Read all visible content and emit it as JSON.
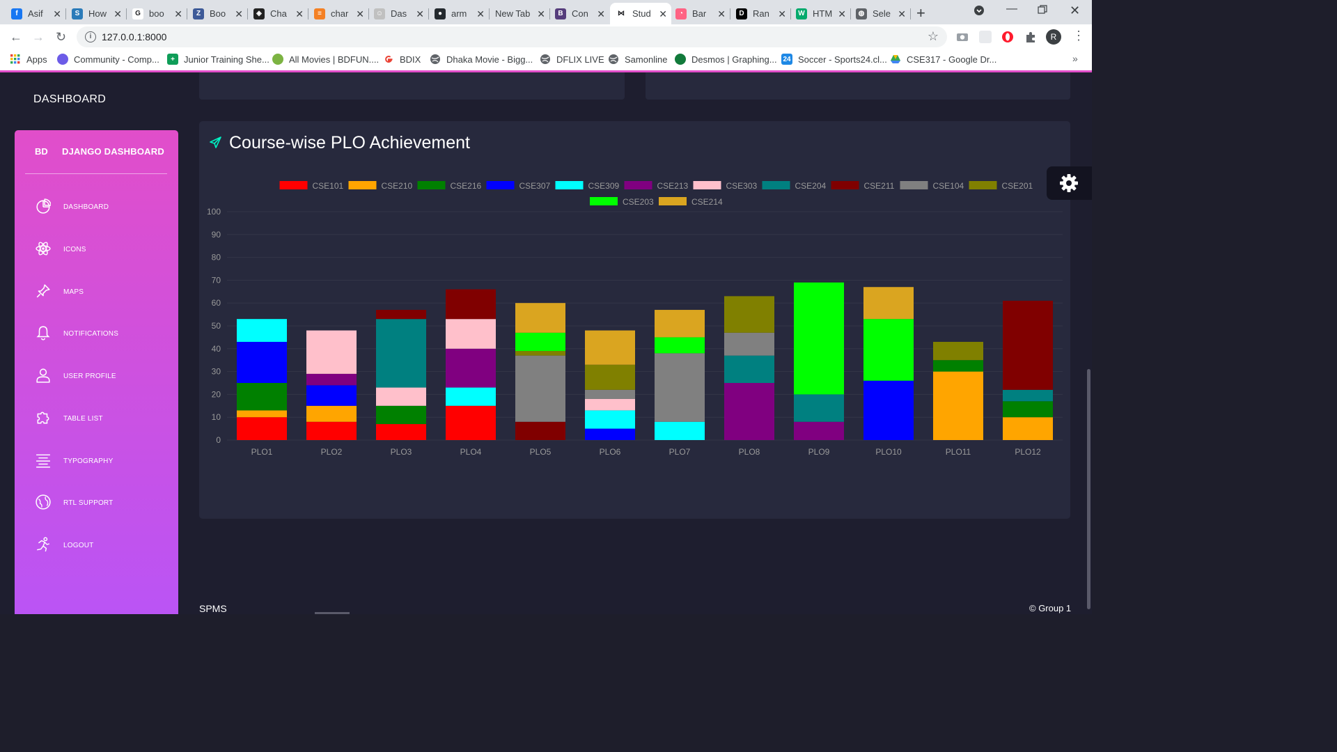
{
  "browser": {
    "tabs": [
      {
        "label": "Asif",
        "favicon": "facebook-icon",
        "color": "#1877f2",
        "glyph": "f"
      },
      {
        "label": "How",
        "favicon": "s-icon",
        "color": "#2b7bb9",
        "glyph": "S"
      },
      {
        "label": "boo",
        "favicon": "google-icon",
        "color": "#ffffff",
        "glyph": "G"
      },
      {
        "label": "Boo",
        "favicon": "bootstrap-icon",
        "color": "#3d5a98",
        "glyph": "Z"
      },
      {
        "label": "Cha",
        "favicon": "codepen-icon",
        "color": "#222222",
        "glyph": "◈"
      },
      {
        "label": "char",
        "favicon": "stackoverflow-icon",
        "color": "#f48024",
        "glyph": "≡"
      },
      {
        "label": "Das",
        "favicon": "page-icon",
        "color": "#c0c0c0",
        "glyph": "☺"
      },
      {
        "label": "arm",
        "favicon": "github-icon",
        "color": "#24292e",
        "glyph": "●"
      },
      {
        "label": "New Tab",
        "favicon": "",
        "color": "",
        "glyph": ""
      },
      {
        "label": "Con",
        "favicon": "bootstrap-b-icon",
        "color": "#563d7c",
        "glyph": "B"
      },
      {
        "label": "Stud",
        "favicon": "bow-icon",
        "color": "#ffffff",
        "glyph": "⋈"
      },
      {
        "label": "Bar",
        "favicon": "chartjs-icon",
        "color": "#ff6384",
        "glyph": "◔"
      },
      {
        "label": "Ran",
        "favicon": "dev-icon",
        "color": "#000000",
        "glyph": "D"
      },
      {
        "label": "HTM",
        "favicon": "w3-icon",
        "color": "#04aa6d",
        "glyph": "W"
      },
      {
        "label": "Sele",
        "favicon": "globe-icon",
        "color": "#5f6368",
        "glyph": "◍"
      }
    ],
    "active_tab": 10,
    "url": "127.0.0.1:8000",
    "profile_initial": "R",
    "bookmarks": [
      {
        "label": "Apps",
        "icon": "apps-grid-icon",
        "color": "#ea4335"
      },
      {
        "label": "Community - Comp...",
        "icon": "community-icon",
        "color": "#6c5ce7"
      },
      {
        "label": "Junior Training She...",
        "icon": "sheets-icon",
        "color": "#0f9d58"
      },
      {
        "label": "All Movies | BDFUN....",
        "icon": "leaf-icon",
        "color": "#7cb342"
      },
      {
        "label": "BDIX",
        "icon": "google-icon",
        "color": "#ea4335"
      },
      {
        "label": "Dhaka Movie - Bigg...",
        "icon": "globe-icon",
        "color": "#5f6368"
      },
      {
        "label": "DFLIX LIVE",
        "icon": "globe-icon",
        "color": "#5f6368"
      },
      {
        "label": "Samonline",
        "icon": "globe-icon",
        "color": "#5f6368"
      },
      {
        "label": "Desmos | Graphing...",
        "icon": "desmos-icon",
        "color": "#127a3b"
      },
      {
        "label": "Soccer - Sports24.cl...",
        "icon": "sports24-icon",
        "color": "#1e88e5"
      },
      {
        "label": "CSE317 - Google Dr...",
        "icon": "drive-icon",
        "color": "#fbbc04"
      }
    ]
  },
  "page": {
    "top_brand": "DASHBOARD",
    "sidebar": {
      "mini": "BD",
      "title": "DJANGO DASHBOARD",
      "items": [
        {
          "label": "DASHBOARD",
          "icon": "chart-pie-icon"
        },
        {
          "label": "ICONS",
          "icon": "atom-icon"
        },
        {
          "label": "MAPS",
          "icon": "pin-icon"
        },
        {
          "label": "NOTIFICATIONS",
          "icon": "bell-icon"
        },
        {
          "label": "USER PROFILE",
          "icon": "user-icon"
        },
        {
          "label": "TABLE LIST",
          "icon": "puzzle-icon"
        },
        {
          "label": "TYPOGRAPHY",
          "icon": "align-center-icon"
        },
        {
          "label": "RTL SUPPORT",
          "icon": "world-icon"
        },
        {
          "label": "LOGOUT",
          "icon": "running-icon"
        }
      ]
    },
    "card": {
      "title": "Course-wise PLO Achievement",
      "icon": "send-icon",
      "icon_color": "#00f2c3"
    },
    "footer": {
      "left": "SPMS",
      "right": "© Group 1"
    }
  },
  "chart_data": {
    "type": "bar",
    "stacked": true,
    "categories": [
      "PLO1",
      "PLO2",
      "PLO3",
      "PLO4",
      "PLO5",
      "PLO6",
      "PLO7",
      "PLO8",
      "PLO9",
      "PLO10",
      "PLO11",
      "PLO12"
    ],
    "ylim": [
      0,
      100
    ],
    "yticks": [
      0,
      10,
      20,
      30,
      40,
      50,
      60,
      70,
      80,
      90,
      100
    ],
    "legend_position": "top",
    "series": [
      {
        "name": "CSE101",
        "color": "#ff0000",
        "values": [
          10,
          8,
          7,
          15,
          0,
          0,
          0,
          0,
          0,
          0,
          0,
          0
        ]
      },
      {
        "name": "CSE210",
        "color": "#ffa500",
        "values": [
          3,
          7,
          0,
          0,
          0,
          0,
          0,
          0,
          0,
          0,
          30,
          10
        ]
      },
      {
        "name": "CSE216",
        "color": "#008000",
        "values": [
          12,
          0,
          8,
          0,
          0,
          0,
          0,
          0,
          0,
          0,
          5,
          7
        ]
      },
      {
        "name": "CSE307",
        "color": "#0000ff",
        "values": [
          18,
          9,
          0,
          0,
          0,
          5,
          0,
          0,
          0,
          26,
          0,
          0
        ]
      },
      {
        "name": "CSE309",
        "color": "#00ffff",
        "values": [
          10,
          0,
          0,
          8,
          0,
          8,
          8,
          0,
          0,
          0,
          0,
          0
        ]
      },
      {
        "name": "CSE213",
        "color": "#800080",
        "values": [
          0,
          5,
          0,
          17,
          0,
          0,
          0,
          25,
          8,
          0,
          0,
          0
        ]
      },
      {
        "name": "CSE303",
        "color": "#ffc0cb",
        "values": [
          0,
          19,
          8,
          13,
          0,
          5,
          0,
          0,
          0,
          0,
          0,
          0
        ]
      },
      {
        "name": "CSE204",
        "color": "#008080",
        "values": [
          0,
          0,
          30,
          0,
          0,
          0,
          0,
          12,
          12,
          0,
          0,
          5
        ]
      },
      {
        "name": "CSE211",
        "color": "#800000",
        "values": [
          0,
          0,
          4,
          13,
          8,
          0,
          0,
          0,
          0,
          0,
          0,
          39
        ]
      },
      {
        "name": "CSE104",
        "color": "#808080",
        "values": [
          0,
          0,
          0,
          0,
          29,
          4,
          30,
          10,
          0,
          0,
          0,
          0
        ]
      },
      {
        "name": "CSE201",
        "color": "#808000",
        "values": [
          0,
          0,
          0,
          0,
          2,
          11,
          0,
          16,
          0,
          0,
          8,
          0
        ]
      },
      {
        "name": "CSE203",
        "color": "#00ff00",
        "values": [
          0,
          0,
          0,
          0,
          8,
          0,
          7,
          0,
          49,
          27,
          0,
          0
        ]
      },
      {
        "name": "CSE214",
        "color": "#daa520",
        "values": [
          0,
          0,
          0,
          0,
          13,
          15,
          12,
          0,
          0,
          14,
          0,
          0
        ]
      }
    ]
  }
}
